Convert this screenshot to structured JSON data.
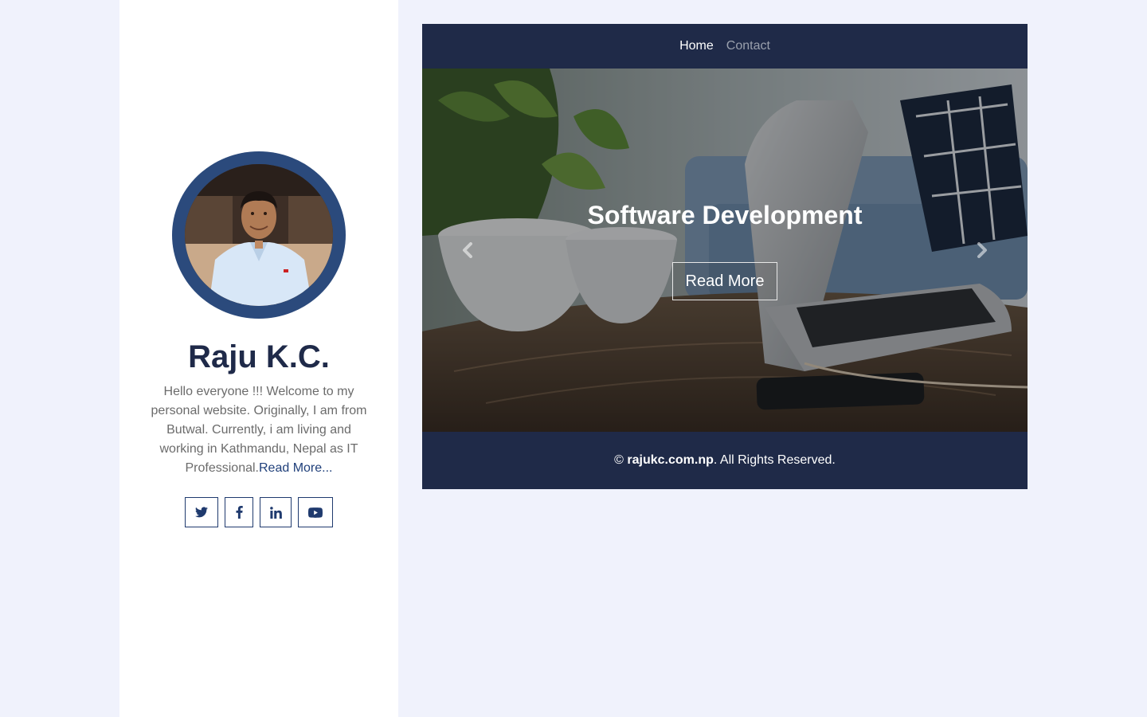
{
  "profile": {
    "name": "Raju K.C.",
    "bio": "Hello everyone !!! Welcome to my personal website. Originally, I am from Butwal. Currently, i am living and working in Kathmandu, Nepal as IT Professional.",
    "read_more_link": "Read More...",
    "socials": [
      {
        "name": "twitter",
        "icon": "twitter-icon"
      },
      {
        "name": "facebook",
        "icon": "facebook-icon"
      },
      {
        "name": "linkedin",
        "icon": "linkedin-icon"
      },
      {
        "name": "youtube",
        "icon": "youtube-icon"
      }
    ]
  },
  "nav": {
    "items": [
      {
        "label": "Home",
        "active": true
      },
      {
        "label": "Contact",
        "active": false
      }
    ]
  },
  "carousel": {
    "slide_title": "Software Development",
    "button_label": "Read More",
    "prev_icon": "chevron-left-icon",
    "next_icon": "chevron-right-icon"
  },
  "footer": {
    "copyright_symbol": "©",
    "site": "rajukc.com.np",
    "rights": ". All Rights Reserved."
  },
  "colors": {
    "page_background": "#f0f2fc",
    "panel_background": "#ffffff",
    "navy": "#1f2a48",
    "avatar_ring": "#2b4a7c",
    "link": "#1f3f7a"
  }
}
